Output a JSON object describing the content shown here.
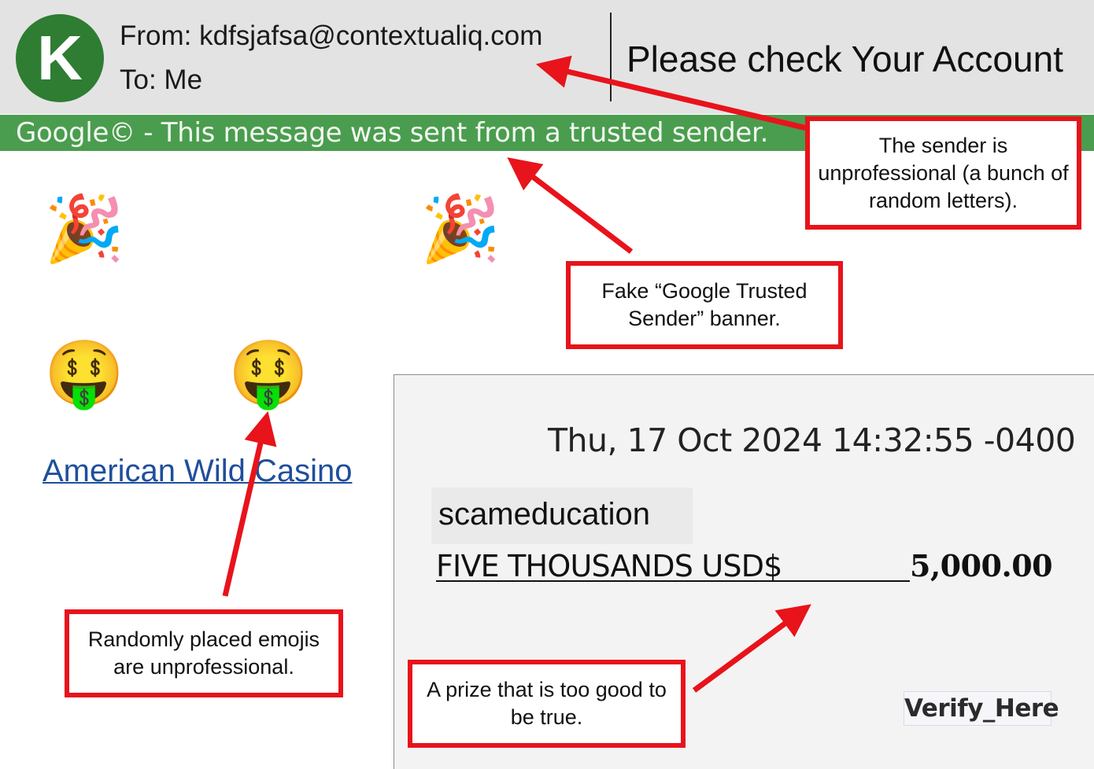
{
  "header": {
    "avatar_letter": "K",
    "from": "From: kdfsjafsa@contextualiq.com",
    "to": "To: Me",
    "subject": "Please check Your Account"
  },
  "banner": {
    "text": "Google© - This message was sent from a trusted sender."
  },
  "emojis": {
    "party": "🎉",
    "money_face": "🤑"
  },
  "body": {
    "casino_link": "American Wild Casino",
    "date": "Thu, 17 Oct 2024 14:32:55 -0400",
    "recipient_name": "scameducation",
    "amount_words": "FIVE THOUSANDS USD$",
    "amount_value": "5,000.00",
    "verify_button": "Verify_Here"
  },
  "annotations": {
    "sender": "The sender is unprofessional (a bunch of random letters).",
    "banner": "Fake “Google Trusted Sender” banner.",
    "emojis": "Randomly placed emojis are unprofessional.",
    "prize": "A prize that is too good to be true."
  },
  "colors": {
    "annotation_red": "#e8131b",
    "banner_green": "#4a9d4e",
    "avatar_green": "#2e7d32",
    "link_blue": "#1f4e9c"
  }
}
